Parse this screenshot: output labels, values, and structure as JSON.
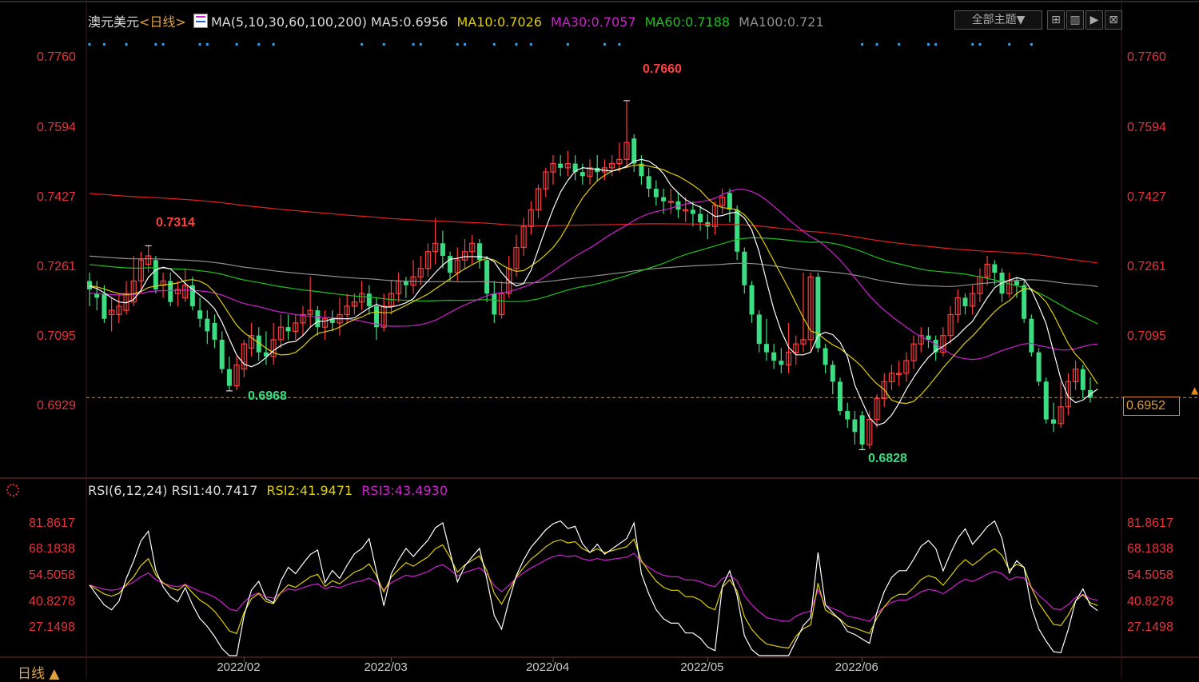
{
  "header": {
    "symbol": "澳元美元",
    "period": "<日线>",
    "ma_params": "MA(5,10,30,60,100,200)",
    "ma5": "MA5:0.6956",
    "ma10": "MA10:0.7026",
    "ma30": "MA30:0.7057",
    "ma60": "MA60:0.7188",
    "ma100": "MA100:0.721",
    "theme_button": "全部主题▼"
  },
  "rsi_header": {
    "params": "RSI(6,12,24)",
    "rsi1": "RSI1:40.7417",
    "rsi2": "RSI2:41.9471",
    "rsi3": "RSI3:43.4930"
  },
  "footer": {
    "period_tab": "日线 ▲"
  },
  "price_axis": [
    "0.7760",
    "0.7594",
    "0.7427",
    "0.7261",
    "0.7095",
    "0.6929"
  ],
  "rsi_axis": [
    "81.8617",
    "68.1838",
    "54.5058",
    "40.8278",
    "27.1498"
  ],
  "date_axis": [
    "2022/02",
    "2022/03",
    "2022/04",
    "2022/05",
    "2022/06"
  ],
  "current_price": "0.6952",
  "annotations": {
    "high_jan": "0.7314",
    "low_jan": "0.6968",
    "high_apr": "0.7660",
    "low_may": "0.6828"
  },
  "colors": {
    "up": "#ff3c3c",
    "down": "#3cdc82",
    "ma5": "#ffffff",
    "ma10": "#e0d000",
    "ma30": "#d020d0",
    "ma60": "#20c020",
    "ma100": "#909090",
    "ma200": "#e02020",
    "rsi1": "#ffffff",
    "rsi2": "#e0d000",
    "rsi3": "#d020d0"
  },
  "chart_data": {
    "type": "candlestick",
    "title": "澳元美元<日线>",
    "ylim": [
      0.676,
      0.782
    ],
    "rsi_ylim": [
      13,
      96
    ],
    "axis_ticks": [
      0.776,
      0.7594,
      0.7427,
      0.7261,
      0.7095,
      0.6929
    ],
    "current_price": 0.6952,
    "closes": [
      0.721,
      0.719,
      0.717,
      0.716,
      0.717,
      0.72,
      0.723,
      0.728,
      0.7314,
      0.726,
      0.723,
      0.721,
      0.72,
      0.722,
      0.719,
      0.716,
      0.714,
      0.711,
      0.706,
      0.699,
      0.6968,
      0.703,
      0.708,
      0.71,
      0.706,
      0.705,
      0.709,
      0.712,
      0.711,
      0.713,
      0.715,
      0.716,
      0.712,
      0.714,
      0.713,
      0.715,
      0.717,
      0.718,
      0.72,
      0.717,
      0.712,
      0.717,
      0.72,
      0.723,
      0.722,
      0.724,
      0.726,
      0.73,
      0.732,
      0.729,
      0.725,
      0.728,
      0.73,
      0.732,
      0.728,
      0.72,
      0.715,
      0.72,
      0.726,
      0.731,
      0.736,
      0.74,
      0.745,
      0.749,
      0.751,
      0.75,
      0.751,
      0.749,
      0.748,
      0.75,
      0.749,
      0.75,
      0.751,
      0.752,
      0.756,
      0.751,
      0.748,
      0.745,
      0.743,
      0.742,
      0.742,
      0.74,
      0.74,
      0.739,
      0.737,
      0.736,
      0.741,
      0.743,
      0.74,
      0.73,
      0.722,
      0.715,
      0.708,
      0.706,
      0.704,
      0.703,
      0.706,
      0.708,
      0.709,
      0.724,
      0.707,
      0.703,
      0.699,
      0.692,
      0.69,
      0.687,
      0.684,
      0.69,
      0.695,
      0.699,
      0.701,
      0.701,
      0.704,
      0.708,
      0.71,
      0.709,
      0.706,
      0.71,
      0.715,
      0.719,
      0.717,
      0.72,
      0.724,
      0.727,
      0.725,
      0.72,
      0.723,
      0.722,
      0.714,
      0.706,
      0.699,
      0.69,
      0.689,
      0.693,
      0.699,
      0.702,
      0.697,
      0.6952
    ],
    "candles": [
      {
        "o": 0.723,
        "h": 0.725,
        "l": 0.717,
        "c": 0.721
      },
      {
        "o": 0.72,
        "h": 0.723,
        "l": 0.716,
        "c": 0.719
      },
      {
        "o": 0.72,
        "h": 0.722,
        "l": 0.713,
        "c": 0.714
      },
      {
        "o": 0.715,
        "h": 0.719,
        "l": 0.711,
        "c": 0.716
      },
      {
        "o": 0.715,
        "h": 0.72,
        "l": 0.713,
        "c": 0.717
      },
      {
        "o": 0.716,
        "h": 0.723,
        "l": 0.715,
        "c": 0.72
      },
      {
        "o": 0.718,
        "h": 0.729,
        "l": 0.717,
        "c": 0.723
      },
      {
        "o": 0.723,
        "h": 0.73,
        "l": 0.72,
        "c": 0.728
      },
      {
        "o": 0.727,
        "h": 0.7314,
        "l": 0.725,
        "c": 0.729
      },
      {
        "o": 0.728,
        "h": 0.729,
        "l": 0.72,
        "c": 0.721
      },
      {
        "o": 0.722,
        "h": 0.725,
        "l": 0.719,
        "c": 0.723
      },
      {
        "o": 0.723,
        "h": 0.725,
        "l": 0.717,
        "c": 0.718
      },
      {
        "o": 0.72,
        "h": 0.723,
        "l": 0.717,
        "c": 0.721
      },
      {
        "o": 0.719,
        "h": 0.726,
        "l": 0.718,
        "c": 0.722
      },
      {
        "o": 0.722,
        "h": 0.724,
        "l": 0.716,
        "c": 0.717
      },
      {
        "o": 0.716,
        "h": 0.719,
        "l": 0.712,
        "c": 0.714
      },
      {
        "o": 0.714,
        "h": 0.716,
        "l": 0.708,
        "c": 0.711
      },
      {
        "o": 0.713,
        "h": 0.715,
        "l": 0.707,
        "c": 0.709
      },
      {
        "o": 0.709,
        "h": 0.711,
        "l": 0.701,
        "c": 0.702
      },
      {
        "o": 0.702,
        "h": 0.705,
        "l": 0.6968,
        "c": 0.698
      },
      {
        "o": 0.698,
        "h": 0.705,
        "l": 0.697,
        "c": 0.703
      },
      {
        "o": 0.702,
        "h": 0.709,
        "l": 0.7,
        "c": 0.708
      },
      {
        "o": 0.707,
        "h": 0.713,
        "l": 0.705,
        "c": 0.71
      },
      {
        "o": 0.71,
        "h": 0.712,
        "l": 0.704,
        "c": 0.706
      },
      {
        "o": 0.706,
        "h": 0.711,
        "l": 0.703,
        "c": 0.705
      },
      {
        "o": 0.705,
        "h": 0.713,
        "l": 0.703,
        "c": 0.709
      },
      {
        "o": 0.709,
        "h": 0.715,
        "l": 0.707,
        "c": 0.712
      },
      {
        "o": 0.712,
        "h": 0.715,
        "l": 0.709,
        "c": 0.711
      },
      {
        "o": 0.711,
        "h": 0.715,
        "l": 0.709,
        "c": 0.713
      },
      {
        "o": 0.713,
        "h": 0.717,
        "l": 0.71,
        "c": 0.715
      },
      {
        "o": 0.715,
        "h": 0.724,
        "l": 0.712,
        "c": 0.716
      },
      {
        "o": 0.716,
        "h": 0.717,
        "l": 0.71,
        "c": 0.712
      },
      {
        "o": 0.712,
        "h": 0.716,
        "l": 0.709,
        "c": 0.714
      },
      {
        "o": 0.714,
        "h": 0.716,
        "l": 0.711,
        "c": 0.713
      },
      {
        "o": 0.713,
        "h": 0.719,
        "l": 0.71,
        "c": 0.715
      },
      {
        "o": 0.715,
        "h": 0.72,
        "l": 0.713,
        "c": 0.717
      },
      {
        "o": 0.717,
        "h": 0.72,
        "l": 0.715,
        "c": 0.718
      },
      {
        "o": 0.718,
        "h": 0.723,
        "l": 0.716,
        "c": 0.72
      },
      {
        "o": 0.72,
        "h": 0.722,
        "l": 0.715,
        "c": 0.717
      },
      {
        "o": 0.717,
        "h": 0.719,
        "l": 0.709,
        "c": 0.712
      },
      {
        "o": 0.712,
        "h": 0.72,
        "l": 0.711,
        "c": 0.717
      },
      {
        "o": 0.717,
        "h": 0.723,
        "l": 0.715,
        "c": 0.72
      },
      {
        "o": 0.72,
        "h": 0.725,
        "l": 0.718,
        "c": 0.723
      },
      {
        "o": 0.723,
        "h": 0.724,
        "l": 0.719,
        "c": 0.722
      },
      {
        "o": 0.722,
        "h": 0.728,
        "l": 0.72,
        "c": 0.724
      },
      {
        "o": 0.724,
        "h": 0.729,
        "l": 0.722,
        "c": 0.726
      },
      {
        "o": 0.726,
        "h": 0.732,
        "l": 0.724,
        "c": 0.73
      },
      {
        "o": 0.73,
        "h": 0.738,
        "l": 0.727,
        "c": 0.732
      },
      {
        "o": 0.732,
        "h": 0.735,
        "l": 0.726,
        "c": 0.729
      },
      {
        "o": 0.729,
        "h": 0.73,
        "l": 0.723,
        "c": 0.725
      },
      {
        "o": 0.725,
        "h": 0.731,
        "l": 0.723,
        "c": 0.728
      },
      {
        "o": 0.728,
        "h": 0.733,
        "l": 0.726,
        "c": 0.73
      },
      {
        "o": 0.73,
        "h": 0.734,
        "l": 0.727,
        "c": 0.732
      },
      {
        "o": 0.732,
        "h": 0.733,
        "l": 0.726,
        "c": 0.728
      },
      {
        "o": 0.728,
        "h": 0.729,
        "l": 0.718,
        "c": 0.72
      },
      {
        "o": 0.72,
        "h": 0.723,
        "l": 0.713,
        "c": 0.715
      },
      {
        "o": 0.715,
        "h": 0.723,
        "l": 0.714,
        "c": 0.72
      },
      {
        "o": 0.72,
        "h": 0.729,
        "l": 0.719,
        "c": 0.726
      },
      {
        "o": 0.726,
        "h": 0.734,
        "l": 0.724,
        "c": 0.731
      },
      {
        "o": 0.731,
        "h": 0.738,
        "l": 0.729,
        "c": 0.736
      },
      {
        "o": 0.736,
        "h": 0.742,
        "l": 0.734,
        "c": 0.74
      },
      {
        "o": 0.74,
        "h": 0.746,
        "l": 0.738,
        "c": 0.745
      },
      {
        "o": 0.745,
        "h": 0.75,
        "l": 0.743,
        "c": 0.749
      },
      {
        "o": 0.749,
        "h": 0.753,
        "l": 0.746,
        "c": 0.751
      },
      {
        "o": 0.751,
        "h": 0.753,
        "l": 0.748,
        "c": 0.75
      },
      {
        "o": 0.75,
        "h": 0.754,
        "l": 0.748,
        "c": 0.751
      },
      {
        "o": 0.751,
        "h": 0.753,
        "l": 0.747,
        "c": 0.749
      },
      {
        "o": 0.749,
        "h": 0.751,
        "l": 0.746,
        "c": 0.748
      },
      {
        "o": 0.748,
        "h": 0.752,
        "l": 0.746,
        "c": 0.75
      },
      {
        "o": 0.75,
        "h": 0.753,
        "l": 0.747,
        "c": 0.749
      },
      {
        "o": 0.749,
        "h": 0.752,
        "l": 0.747,
        "c": 0.75
      },
      {
        "o": 0.75,
        "h": 0.753,
        "l": 0.748,
        "c": 0.751
      },
      {
        "o": 0.751,
        "h": 0.756,
        "l": 0.749,
        "c": 0.752
      },
      {
        "o": 0.752,
        "h": 0.766,
        "l": 0.75,
        "c": 0.756
      },
      {
        "o": 0.757,
        "h": 0.758,
        "l": 0.749,
        "c": 0.751
      },
      {
        "o": 0.751,
        "h": 0.753,
        "l": 0.746,
        "c": 0.748
      },
      {
        "o": 0.748,
        "h": 0.75,
        "l": 0.743,
        "c": 0.745
      },
      {
        "o": 0.745,
        "h": 0.747,
        "l": 0.741,
        "c": 0.743
      },
      {
        "o": 0.743,
        "h": 0.745,
        "l": 0.739,
        "c": 0.742
      },
      {
        "o": 0.742,
        "h": 0.745,
        "l": 0.739,
        "c": 0.742
      },
      {
        "o": 0.742,
        "h": 0.744,
        "l": 0.738,
        "c": 0.74
      },
      {
        "o": 0.74,
        "h": 0.743,
        "l": 0.737,
        "c": 0.74
      },
      {
        "o": 0.74,
        "h": 0.742,
        "l": 0.736,
        "c": 0.739
      },
      {
        "o": 0.739,
        "h": 0.741,
        "l": 0.735,
        "c": 0.737
      },
      {
        "o": 0.737,
        "h": 0.739,
        "l": 0.733,
        "c": 0.736
      },
      {
        "o": 0.736,
        "h": 0.742,
        "l": 0.734,
        "c": 0.741
      },
      {
        "o": 0.741,
        "h": 0.745,
        "l": 0.739,
        "c": 0.743
      },
      {
        "o": 0.744,
        "h": 0.745,
        "l": 0.737,
        "c": 0.74
      },
      {
        "o": 0.74,
        "h": 0.741,
        "l": 0.728,
        "c": 0.73
      },
      {
        "o": 0.73,
        "h": 0.731,
        "l": 0.72,
        "c": 0.722
      },
      {
        "o": 0.722,
        "h": 0.723,
        "l": 0.713,
        "c": 0.715
      },
      {
        "o": 0.715,
        "h": 0.716,
        "l": 0.706,
        "c": 0.708
      },
      {
        "o": 0.708,
        "h": 0.714,
        "l": 0.704,
        "c": 0.706
      },
      {
        "o": 0.706,
        "h": 0.708,
        "l": 0.702,
        "c": 0.704
      },
      {
        "o": 0.704,
        "h": 0.707,
        "l": 0.701,
        "c": 0.703
      },
      {
        "o": 0.703,
        "h": 0.713,
        "l": 0.701,
        "c": 0.706
      },
      {
        "o": 0.706,
        "h": 0.71,
        "l": 0.703,
        "c": 0.708
      },
      {
        "o": 0.708,
        "h": 0.725,
        "l": 0.706,
        "c": 0.709
      },
      {
        "o": 0.709,
        "h": 0.725,
        "l": 0.706,
        "c": 0.724
      },
      {
        "o": 0.724,
        "h": 0.725,
        "l": 0.706,
        "c": 0.707
      },
      {
        "o": 0.707,
        "h": 0.708,
        "l": 0.701,
        "c": 0.703
      },
      {
        "o": 0.703,
        "h": 0.704,
        "l": 0.696,
        "c": 0.699
      },
      {
        "o": 0.699,
        "h": 0.7,
        "l": 0.691,
        "c": 0.692
      },
      {
        "o": 0.692,
        "h": 0.694,
        "l": 0.688,
        "c": 0.69
      },
      {
        "o": 0.69,
        "h": 0.692,
        "l": 0.684,
        "c": 0.687
      },
      {
        "o": 0.691,
        "h": 0.692,
        "l": 0.6828,
        "c": 0.684
      },
      {
        "o": 0.684,
        "h": 0.692,
        "l": 0.683,
        "c": 0.69
      },
      {
        "o": 0.69,
        "h": 0.696,
        "l": 0.688,
        "c": 0.695
      },
      {
        "o": 0.695,
        "h": 0.701,
        "l": 0.693,
        "c": 0.699
      },
      {
        "o": 0.699,
        "h": 0.703,
        "l": 0.697,
        "c": 0.701
      },
      {
        "o": 0.701,
        "h": 0.704,
        "l": 0.698,
        "c": 0.701
      },
      {
        "o": 0.701,
        "h": 0.706,
        "l": 0.699,
        "c": 0.704
      },
      {
        "o": 0.704,
        "h": 0.71,
        "l": 0.702,
        "c": 0.708
      },
      {
        "o": 0.708,
        "h": 0.712,
        "l": 0.706,
        "c": 0.71
      },
      {
        "o": 0.71,
        "h": 0.712,
        "l": 0.707,
        "c": 0.709
      },
      {
        "o": 0.709,
        "h": 0.71,
        "l": 0.704,
        "c": 0.706
      },
      {
        "o": 0.706,
        "h": 0.712,
        "l": 0.705,
        "c": 0.71
      },
      {
        "o": 0.71,
        "h": 0.717,
        "l": 0.708,
        "c": 0.715
      },
      {
        "o": 0.715,
        "h": 0.721,
        "l": 0.713,
        "c": 0.719
      },
      {
        "o": 0.719,
        "h": 0.72,
        "l": 0.715,
        "c": 0.717
      },
      {
        "o": 0.717,
        "h": 0.722,
        "l": 0.715,
        "c": 0.72
      },
      {
        "o": 0.72,
        "h": 0.726,
        "l": 0.718,
        "c": 0.724
      },
      {
        "o": 0.724,
        "h": 0.729,
        "l": 0.722,
        "c": 0.727
      },
      {
        "o": 0.727,
        "h": 0.728,
        "l": 0.722,
        "c": 0.725
      },
      {
        "o": 0.725,
        "h": 0.726,
        "l": 0.718,
        "c": 0.72
      },
      {
        "o": 0.72,
        "h": 0.725,
        "l": 0.719,
        "c": 0.723
      },
      {
        "o": 0.723,
        "h": 0.724,
        "l": 0.719,
        "c": 0.722
      },
      {
        "o": 0.722,
        "h": 0.723,
        "l": 0.713,
        "c": 0.714
      },
      {
        "o": 0.714,
        "h": 0.715,
        "l": 0.705,
        "c": 0.706
      },
      {
        "o": 0.706,
        "h": 0.707,
        "l": 0.698,
        "c": 0.699
      },
      {
        "o": 0.699,
        "h": 0.7,
        "l": 0.689,
        "c": 0.69
      },
      {
        "o": 0.69,
        "h": 0.694,
        "l": 0.687,
        "c": 0.689
      },
      {
        "o": 0.689,
        "h": 0.699,
        "l": 0.688,
        "c": 0.693
      },
      {
        "o": 0.693,
        "h": 0.701,
        "l": 0.691,
        "c": 0.699
      },
      {
        "o": 0.699,
        "h": 0.704,
        "l": 0.697,
        "c": 0.702
      },
      {
        "o": 0.702,
        "h": 0.703,
        "l": 0.695,
        "c": 0.697
      },
      {
        "o": 0.697,
        "h": 0.7,
        "l": 0.694,
        "c": 0.6952
      }
    ],
    "dots_count": 28
  }
}
